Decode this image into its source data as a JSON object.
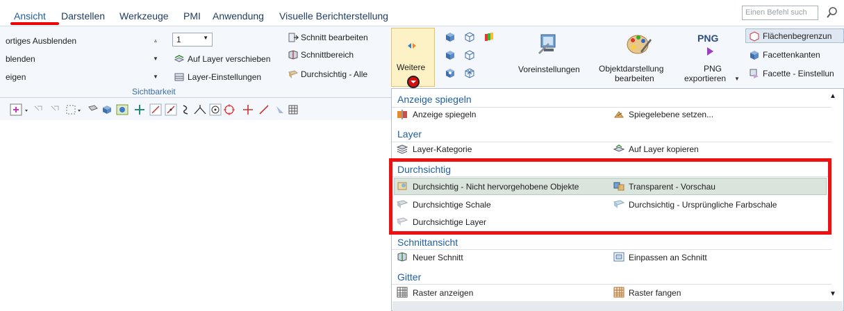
{
  "menubar": {
    "tabs": [
      "Ansicht",
      "Darstellen",
      "Werkzeuge",
      "PMI",
      "Anwendung",
      "Visuelle Berichterstellung"
    ],
    "search_placeholder": "Einen Befehl such"
  },
  "ribbon": {
    "left_items": [
      "ortiges Ausblenden",
      "blenden",
      "eigen"
    ],
    "layer_combo_value": "1",
    "layer_items": [
      "Auf Layer verschieben",
      "Layer-Einstellungen"
    ],
    "group_label": "Sichtbarkeit",
    "schnitt_items": [
      "Schnitt bearbeiten",
      "Schnittbereich",
      "Durchsichtig - Alle"
    ],
    "weitere_label": "Weitere",
    "voreinstellungen": "Voreinstellungen",
    "objektdarstellung": [
      "Objektdarstellung",
      "bearbeiten"
    ],
    "png_title": "PNG",
    "png_label": [
      "PNG",
      "exportieren"
    ],
    "right_items": [
      "Flächenbegrenzun",
      "Facettenkanten",
      "Facette - Einstellun"
    ]
  },
  "dropdown": {
    "sections": [
      {
        "title": "Anzeige spiegeln",
        "items": [
          "Anzeige spiegeln",
          "Spiegelebene setzen..."
        ]
      },
      {
        "title": "Layer",
        "items": [
          "Layer-Kategorie",
          "Auf Layer kopieren"
        ]
      },
      {
        "title": "Durchsichtig",
        "items": [
          "Durchsichtig - Nicht hervorgehobene Objekte",
          "Transparent - Vorschau",
          "Durchsichtige Schale",
          "Durchsichtig - Ursprüngliche Farbschale",
          "Durchsichtige Layer"
        ]
      },
      {
        "title": "Schnittansicht",
        "items": [
          "Neuer Schnitt",
          "Einpassen an Schnitt"
        ]
      },
      {
        "title": "Gitter",
        "items": [
          "Raster anzeigen",
          "Raster fangen"
        ]
      }
    ]
  },
  "colors": {
    "highlight_box": "#ee1111",
    "section_title": "#1f5fa0",
    "hover_row": "#d9e4dc"
  }
}
